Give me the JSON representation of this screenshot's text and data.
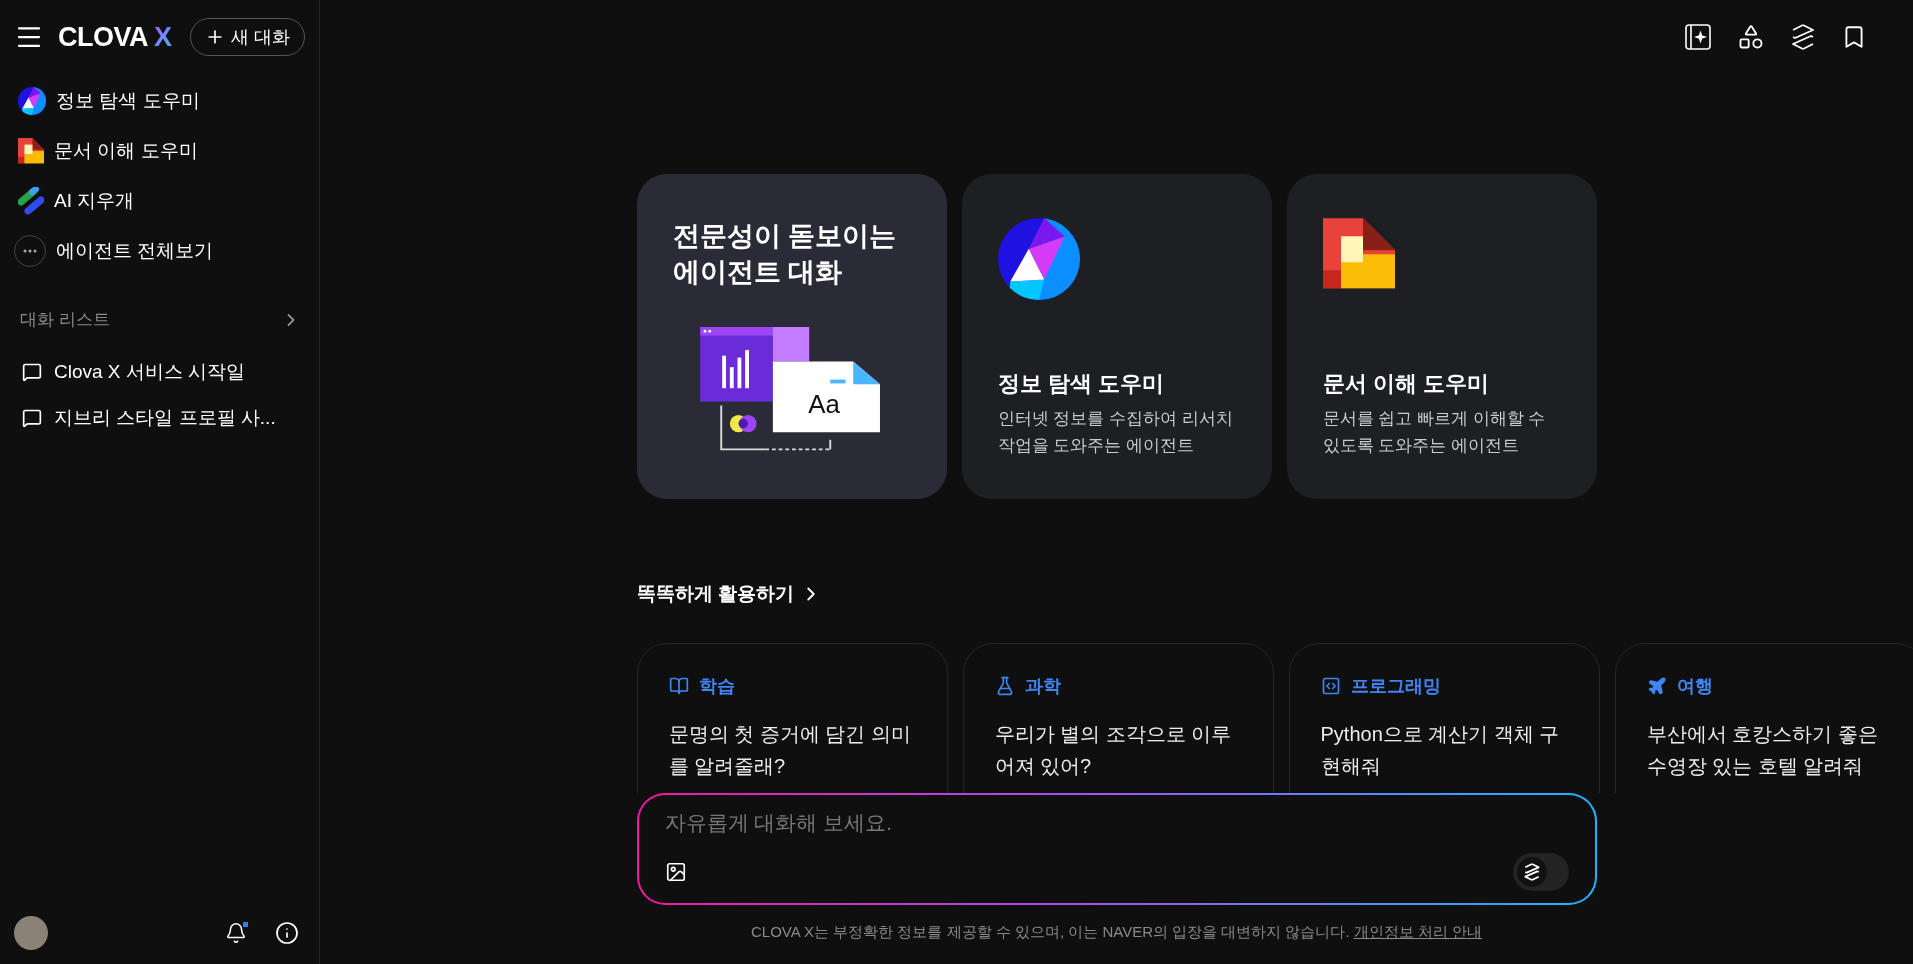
{
  "sidebar": {
    "logo": {
      "text": "CLOVA",
      "mark": "X"
    },
    "new_chat": "새 대화",
    "agents": [
      {
        "kind": "search",
        "label": "정보 탐색 도우미"
      },
      {
        "kind": "document",
        "label": "문서 이해 도우미"
      },
      {
        "kind": "eraser",
        "label": "AI 지우개"
      },
      {
        "kind": "more",
        "label": "에이전트 전체보기"
      }
    ],
    "chat_list_title": "대화 리스트",
    "chats": [
      {
        "title": "Clova X 서비스 시작일"
      },
      {
        "title": "지브리 스타일 프로필 사..."
      }
    ],
    "notifications": {
      "unread": true
    }
  },
  "feature_cards": [
    {
      "kind": "intro",
      "title": "전문성이 돋보이는\n에이전트 대화",
      "illustration_text": "Aa"
    },
    {
      "kind": "search",
      "title": "정보 탐색 도우미",
      "description": "인터넷 정보를 수집하여 리서치\n작업을 도와주는 에이전트"
    },
    {
      "kind": "document",
      "title": "문서 이해 도우미",
      "description": "문서를 쉽고 빠르게 이해할 수\n있도록 도와주는 에이전트"
    }
  ],
  "suggestions_title": "똑똑하게 활용하기",
  "suggestions": [
    {
      "kind": "study",
      "category": "학습",
      "prompt": "문명의 첫 증거에 담긴 의미\n를 알려줄래?"
    },
    {
      "kind": "science",
      "category": "과학",
      "prompt": "우리가 별의 조각으로 이루\n어져 있어?"
    },
    {
      "kind": "code",
      "category": "프로그래밍",
      "prompt": "Python으로 계산기 객체 구\n현해줘"
    },
    {
      "kind": "travel",
      "category": "여행",
      "prompt": "부산에서 호캉스하기 좋은\n수영장 있는 호텔 알려줘"
    }
  ],
  "composer": {
    "placeholder": "자유롭게 대화해 보세요.",
    "mode_switch": {
      "on": false
    }
  },
  "footer": {
    "notice": "CLOVA X는 부정확한 정보를 제공할 수 있으며, 이는 NAVER의 입장을 대변하지 않습니다.",
    "link": "개인정보 처리 안내"
  }
}
